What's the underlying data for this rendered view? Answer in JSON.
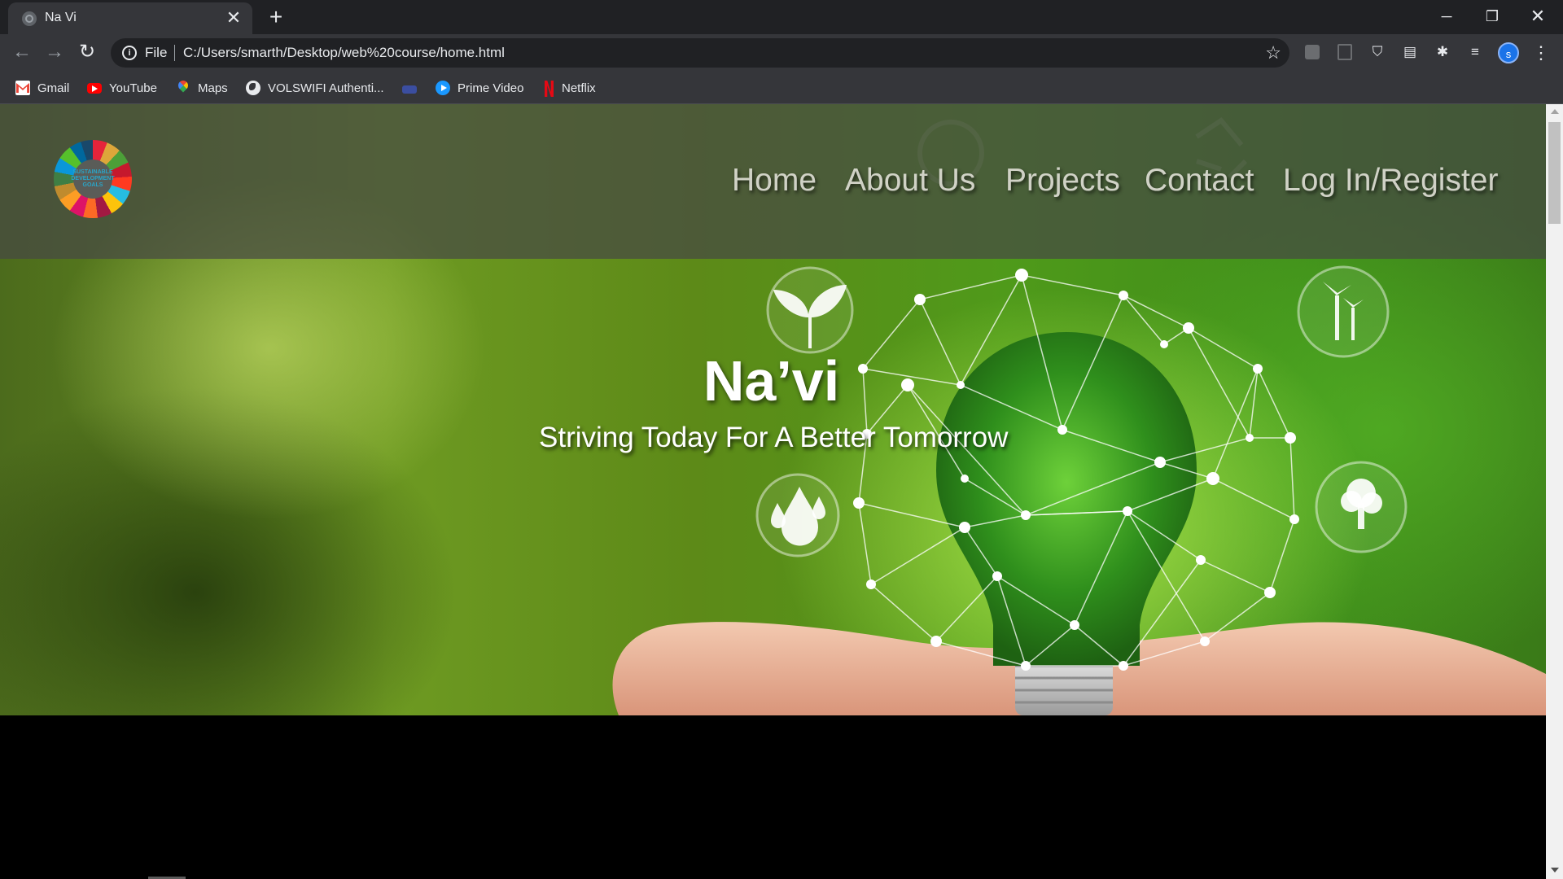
{
  "browser": {
    "tab": {
      "title": "Na Vi",
      "close": "✕"
    },
    "new_tab": "+",
    "window": {
      "minimize": "─",
      "maximize": "❐",
      "close": "✕"
    },
    "nav": {
      "back": "←",
      "forward": "→",
      "reload": "↻"
    },
    "omnibox": {
      "info": "i",
      "scheme": "File",
      "url": "C:/Users/smarth/Desktop/web%20course/home.html",
      "star": "☆"
    },
    "extensions": {
      "shield": "⛉",
      "reader": "▤",
      "puzzle": "✱",
      "media": "≡"
    },
    "profile_initial": "s",
    "menu": "⋮",
    "bookmarks": [
      {
        "label": "Gmail",
        "icon": "gmail-icon"
      },
      {
        "label": "YouTube",
        "icon": "youtube-icon"
      },
      {
        "label": "Maps",
        "icon": "maps-icon"
      },
      {
        "label": "VOLSWIFI Authenti...",
        "icon": "globe-icon"
      },
      {
        "label": "",
        "icon": "bookmark-icon"
      },
      {
        "label": "Prime Video",
        "icon": "prime-video-icon"
      },
      {
        "label": "Netflix",
        "icon": "netflix-icon"
      }
    ]
  },
  "site": {
    "logo": "SUSTAINABLE DEVELOPMENT GOALS",
    "nav": [
      "Home",
      "About Us",
      "Projects",
      "Contact",
      "Log In/Register"
    ],
    "hero": {
      "title": "Na’vi",
      "subtitle": "Striving Today For A Better Tomorrow"
    }
  },
  "colors": {
    "chrome_dark": "#202124",
    "chrome_toolbar": "#35363a",
    "header_band": "#464844",
    "hero_green": "#5d8a18",
    "page_bg": "#000000"
  }
}
